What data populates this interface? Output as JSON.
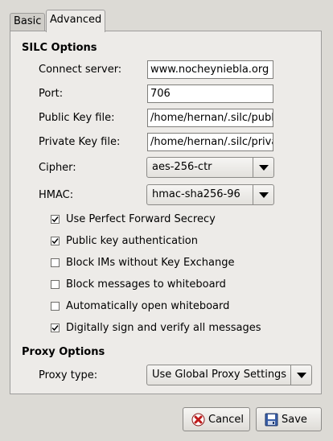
{
  "tabs": {
    "basic": "Basic",
    "advanced": "Advanced"
  },
  "silc": {
    "title": "SILC Options",
    "connect_server": {
      "label": "Connect server:",
      "value": "www.nocheyniebla.org"
    },
    "port": {
      "label": "Port:",
      "value": "706"
    },
    "public_key": {
      "label": "Public Key file:",
      "value": "/home/hernan/.silc/public_key.pub"
    },
    "private_key": {
      "label": "Private Key file:",
      "value": "/home/hernan/.silc/private_key.prv"
    },
    "cipher": {
      "label": "Cipher:",
      "value": "aes-256-ctr"
    },
    "hmac": {
      "label": "HMAC:",
      "value": "hmac-sha256-96"
    },
    "checks": [
      {
        "label": "Use Perfect Forward Secrecy",
        "checked": true
      },
      {
        "label": "Public key authentication",
        "checked": true
      },
      {
        "label": "Block IMs without Key Exchange",
        "checked": false
      },
      {
        "label": "Block messages to whiteboard",
        "checked": false
      },
      {
        "label": "Automatically open whiteboard",
        "checked": false
      },
      {
        "label": "Digitally sign and verify all messages",
        "checked": true
      }
    ]
  },
  "proxy": {
    "title": "Proxy Options",
    "type": {
      "label": "Proxy type:",
      "value": "Use Global Proxy Settings"
    }
  },
  "buttons": {
    "cancel": "Cancel",
    "save": "Save"
  },
  "colors": {
    "cancel_icon": "#c01a1a",
    "save_icon": "#3a5fa8"
  }
}
